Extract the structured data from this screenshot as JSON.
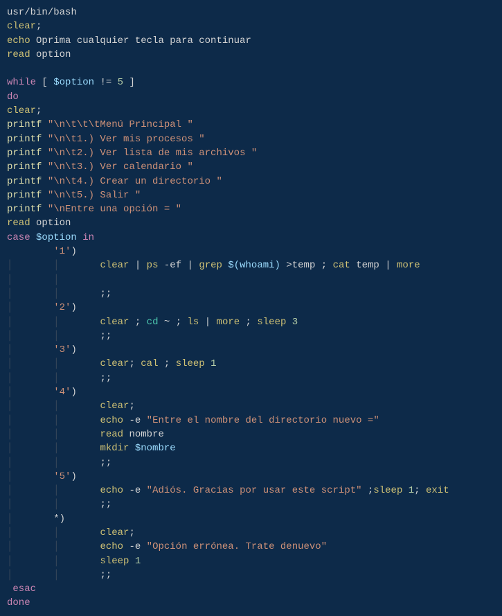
{
  "lines": {
    "l1_seg1": "usr",
    "l1_seg2": "/",
    "l1_seg3": "bin",
    "l1_seg4": "/",
    "l1_seg5": "bash",
    "l2_cmd": "clear",
    "l2_semi": ";",
    "l3_cmd": "echo",
    "l3_text": " Oprima cualquier tecla para continuar",
    "l4_cmd": "read",
    "l4_var": " option",
    "l6_kw": "while",
    "l6_rest": " [ ",
    "l6_var": "$option",
    "l6_op": " != ",
    "l6_num": "5",
    "l6_end": " ]",
    "l7_kw": "do",
    "l8_cmd": "clear",
    "l8_semi": ";",
    "l9_cmd": "printf",
    "l9_str": " \"\\n\\t\\t\\tMenú Principal \"",
    "l10_cmd": "printf",
    "l10_str": " \"\\n\\t1.) Ver mis procesos \"",
    "l11_cmd": "printf",
    "l11_str": " \"\\n\\t2.) Ver lista de mis archivos \"",
    "l12_cmd": "printf",
    "l12_str": " \"\\n\\t3.) Ver calendario \"",
    "l13_cmd": "printf",
    "l13_str": " \"\\n\\t4.) Crear un directorio \"",
    "l14_cmd": "printf",
    "l14_str": " \"\\n\\t5.) Salir \"",
    "l15_cmd": "printf",
    "l15_str": " \"\\nEntre una opción = \"",
    "l16_cmd": "read",
    "l16_var": " option",
    "l17_kw1": "case",
    "l17_var": " $option",
    "l17_kw2": " in",
    "c1_indent": "        ",
    "c1_label": "'1'",
    "c1_paren": ")",
    "c1b_indent": "                ",
    "c1b_cmd1": "clear",
    "c1b_pipe1": " | ",
    "c1b_cmd2": "ps",
    "c1b_flag1": " -ef",
    "c1b_pipe2": " | ",
    "c1b_cmd3": "grep",
    "c1b_sub": " $(whoami)",
    "c1b_op": " >",
    "c1b_text": "temp ",
    "c1b_semi": "; ",
    "c1b_cmd4": "cat",
    "c1b_text2": " temp ",
    "c1b_pipe3": "| ",
    "c1b_cmd5": "more",
    "c1c_indent": "                ",
    "c1c_dsemi": ";;",
    "c2_indent": "        ",
    "c2_label": "'2'",
    "c2_paren": ")",
    "c2b_indent": "                ",
    "c2b_cmd1": "clear",
    "c2b_semi1": " ; ",
    "c2b_cmd2": "cd",
    "c2b_tilde": " ~ ",
    "c2b_semi2": "; ",
    "c2b_cmd3": "ls",
    "c2b_pipe": " | ",
    "c2b_cmd4": "more",
    "c2b_semi3": " ; ",
    "c2b_cmd5": "sleep",
    "c2b_num": " 3",
    "c2c_indent": "                ",
    "c2c_dsemi": ";;",
    "c3_indent": "        ",
    "c3_label": "'3'",
    "c3_paren": ")",
    "c3b_indent": "                ",
    "c3b_cmd1": "clear",
    "c3b_semi1": "; ",
    "c3b_cmd2": "cal",
    "c3b_semi2": " ; ",
    "c3b_cmd3": "sleep",
    "c3b_num": " 1",
    "c3c_indent": "                ",
    "c3c_dsemi": ";;",
    "c4_indent": "        ",
    "c4_label": "'4'",
    "c4_paren": ")",
    "c4b_indent": "                ",
    "c4b_cmd": "clear",
    "c4b_semi": ";",
    "c4c_indent": "                ",
    "c4c_cmd": "echo",
    "c4c_flag": " -e",
    "c4c_str": " \"Entre el nombre del directorio nuevo =\"",
    "c4d_indent": "                ",
    "c4d_cmd": "read",
    "c4d_var": " nombre",
    "c4e_indent": "                ",
    "c4e_cmd": "mkdir",
    "c4e_var": " $nombre",
    "c4f_indent": "                ",
    "c4f_dsemi": ";;",
    "c5_indent": "        ",
    "c5_label": "'5'",
    "c5_paren": ")",
    "c5b_indent": "                ",
    "c5b_cmd1": "echo",
    "c5b_flag": " -e",
    "c5b_str": " \"Adiós. Gracias por usar este script\"",
    "c5b_semi1": " ;",
    "c5b_cmd2": "sleep",
    "c5b_num": " 1",
    "c5b_semi2": "; ",
    "c5b_cmd3": "exit",
    "c5c_indent": "                ",
    "c5c_dsemi": ";;",
    "cd_indent": "        ",
    "cd_label": "*",
    "cd_paren": ")",
    "cdb_indent": "                ",
    "cdb_cmd": "clear",
    "cdb_semi": ";",
    "cdc_indent": "                ",
    "cdc_cmd": "echo",
    "cdc_flag": " -e",
    "cdc_str": " \"Opción errónea. Trate denuevo\"",
    "cdd_indent": "                ",
    "cdd_cmd": "sleep",
    "cdd_num": " 1",
    "cde_indent": "                ",
    "cde_dsemi": ";;",
    "esac_indent": " ",
    "esac_kw": "esac",
    "done_kw": "done",
    "blank": " ",
    "g1": "        ",
    "g2": "│       ",
    "g1p": "│       "
  }
}
